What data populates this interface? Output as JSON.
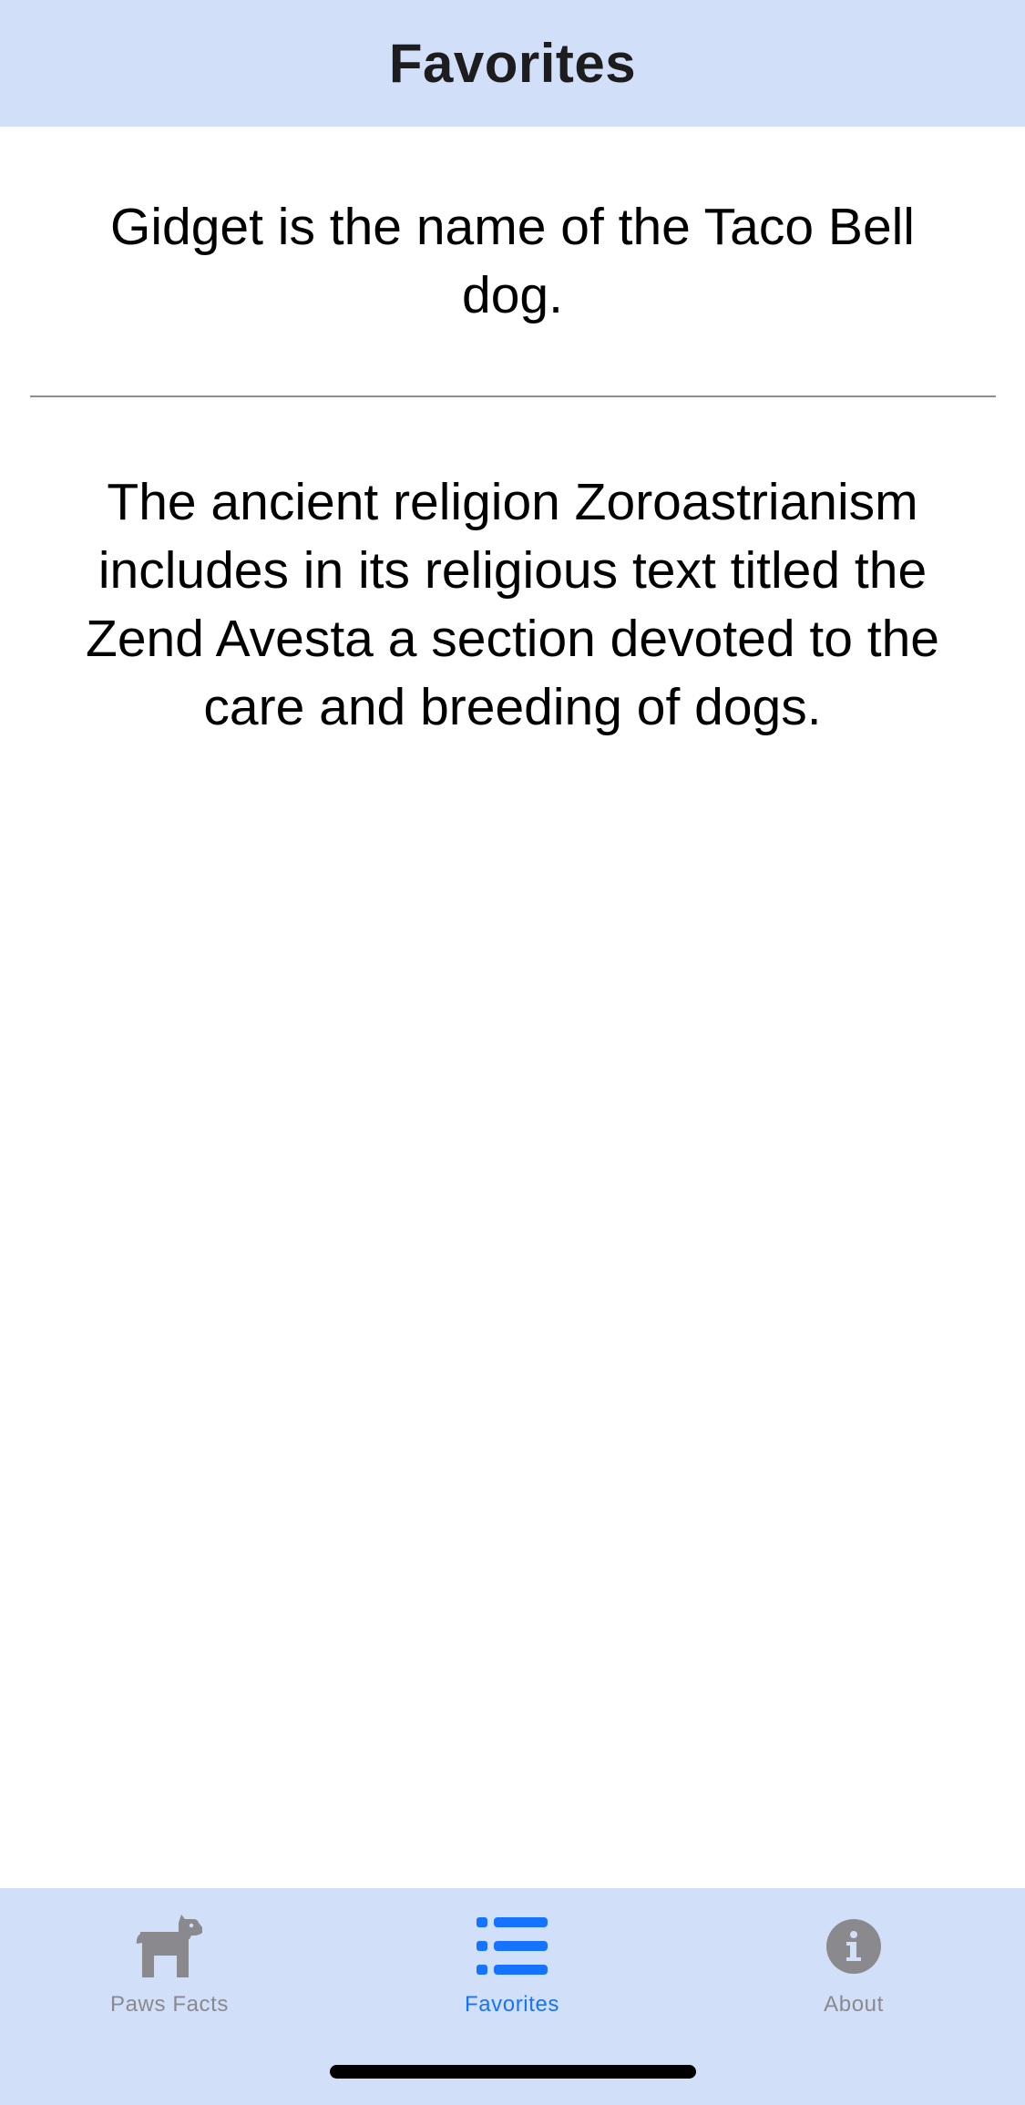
{
  "header": {
    "title": "Favorites"
  },
  "favorites": [
    {
      "text": "Gidget is the name of the Taco Bell dog."
    },
    {
      "text": "The ancient religion Zoroastrianism includes in its religious text titled the Zend Avesta a section devoted to the care and breeding of dogs."
    }
  ],
  "tab_bar": {
    "active": "Favorites",
    "tabs": [
      {
        "label": "Paws Facts",
        "icon": "dog-icon"
      },
      {
        "label": "Favorites",
        "icon": "list-icon"
      },
      {
        "label": "About",
        "icon": "info-icon"
      }
    ]
  },
  "colors": {
    "bar_background": "#d2dff8",
    "active_tab": "#1673ff",
    "inactive_tab": "#8a8a8e",
    "divider": "#8e8e8e"
  }
}
